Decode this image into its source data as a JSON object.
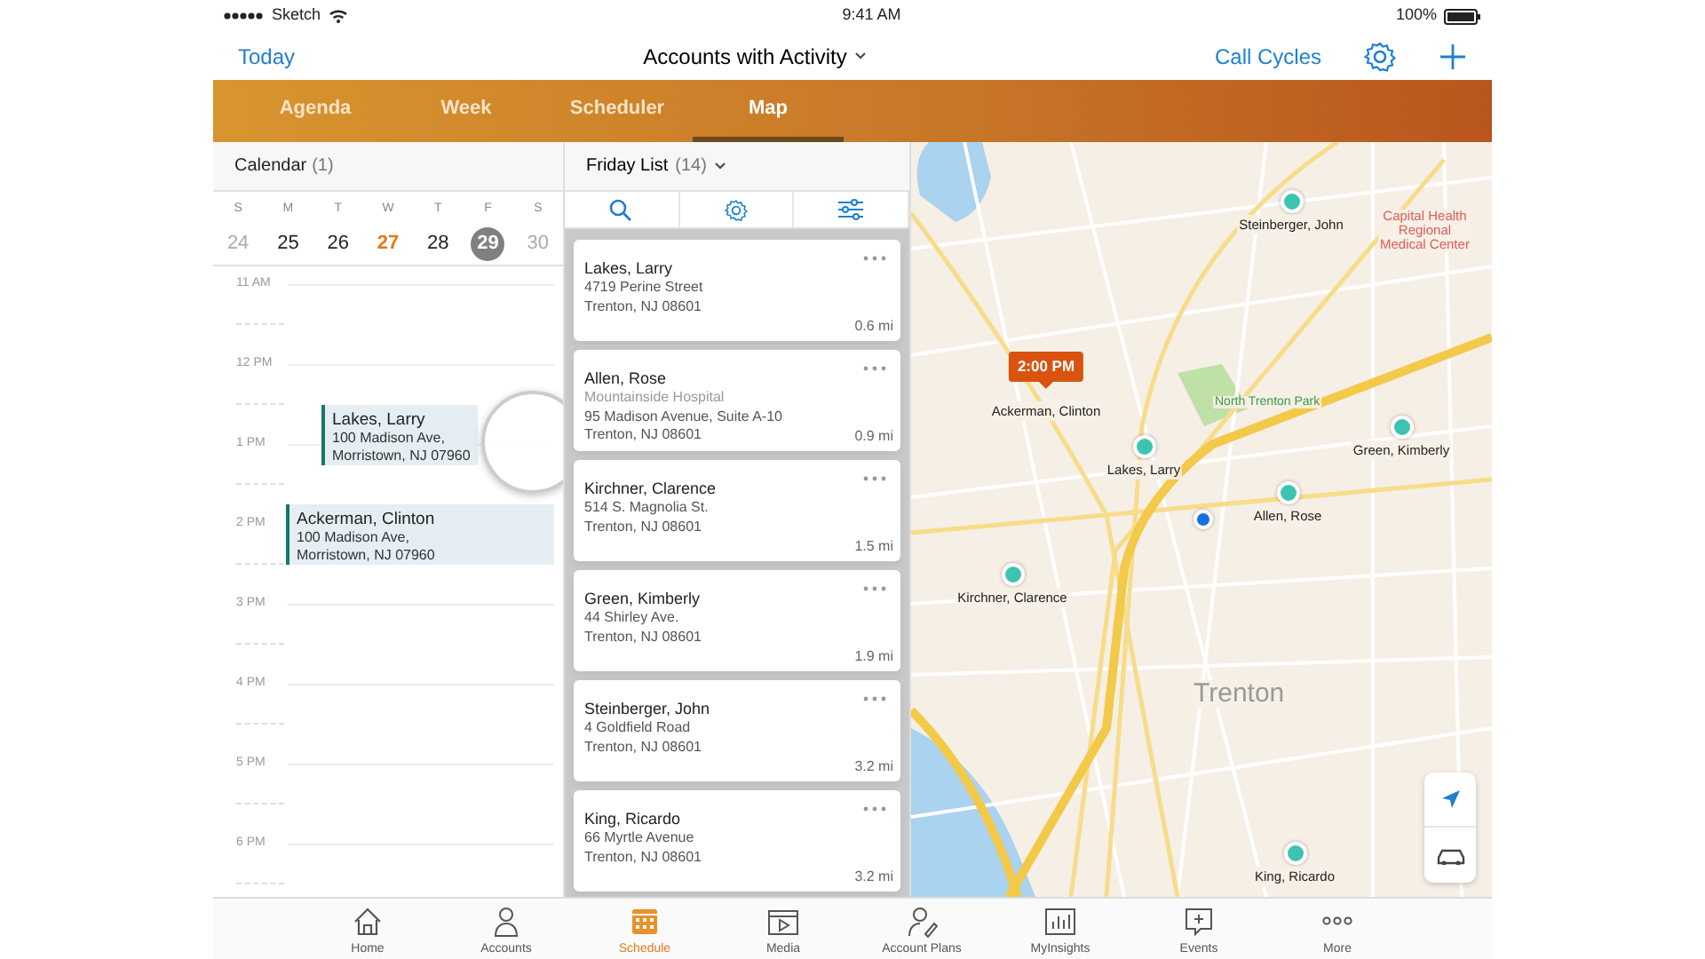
{
  "status_bar": {
    "carrier": "Sketch",
    "time": "9:41 AM",
    "battery": "100%"
  },
  "nav_bar": {
    "left": "Today",
    "title": "Accounts with Activity",
    "right": "Call Cycles"
  },
  "view_tabs": [
    {
      "label": "Agenda",
      "selected": false
    },
    {
      "label": "Week",
      "selected": false
    },
    {
      "label": "Scheduler",
      "selected": false
    },
    {
      "label": "Map",
      "selected": true
    }
  ],
  "calendar": {
    "title": "Calendar",
    "count": "(1)",
    "weekdays": [
      "S",
      "M",
      "T",
      "W",
      "T",
      "F",
      "S"
    ],
    "dates": [
      {
        "label": "24",
        "kind": "muted",
        "selected": false
      },
      {
        "label": "25",
        "kind": "normal",
        "selected": false
      },
      {
        "label": "26",
        "kind": "normal",
        "selected": false
      },
      {
        "label": "27",
        "kind": "today",
        "selected": false
      },
      {
        "label": "28",
        "kind": "normal",
        "selected": false
      },
      {
        "label": "29",
        "kind": "normal",
        "selected": true
      },
      {
        "label": "30",
        "kind": "muted",
        "selected": false
      }
    ],
    "slots": [
      {
        "time": "11 AM"
      },
      {
        "time": "12 PM"
      },
      {
        "time": "1 PM",
        "events": [
          {
            "name": "Lakes, Larry",
            "address": "100 Madison Ave,",
            "city": "Morristown, NJ 07960",
            "dragging": true
          }
        ]
      },
      {
        "time": "2 PM",
        "events": [
          {
            "name": "Ackerman, Clinton",
            "address": "100 Madison Ave,",
            "city": "Morristown, NJ 07960",
            "dragging": false
          }
        ]
      },
      {
        "time": "3 PM"
      },
      {
        "time": "4 PM"
      },
      {
        "time": "5 PM"
      },
      {
        "time": "6 PM"
      }
    ]
  },
  "list": {
    "title": "Friday List",
    "count": "(14)",
    "accounts": [
      {
        "name": "Lakes, Larry",
        "street": "4719 Perine Street",
        "city": "Trenton, NJ 08601",
        "distance": "0.6 mi"
      },
      {
        "name": "Allen, Rose",
        "organization": "Mountainside Hospital",
        "street": "95 Madison Avenue, Suite A-10",
        "city": "Trenton, NJ 08601",
        "distance": "0.9 mi"
      },
      {
        "name": "Kirchner, Clarence",
        "street": "514 S. Magnolia St.",
        "city": "Trenton, NJ 08601",
        "distance": "1.5 mi"
      },
      {
        "name": "Green, Kimberly",
        "street": "44 Shirley Ave.",
        "city": "Trenton, NJ 08601",
        "distance": "1.9 mi"
      },
      {
        "name": "Steinberger, John",
        "street": "4 Goldfield Road",
        "city": "Trenton, NJ 08601",
        "distance": "3.2 mi"
      },
      {
        "name": "King, Ricardo",
        "street": "66 Myrtle Avenue",
        "city": "Trenton, NJ 08601",
        "distance": "3.2 mi"
      }
    ]
  },
  "map": {
    "places": [
      "Capital Health\nRegional\nMedical Center",
      "North Trenton Park",
      "Trenton"
    ],
    "pins": [
      {
        "name": "Steinberger, John"
      },
      {
        "name": "Ackerman, Clinton",
        "callout": "2:00 PM"
      },
      {
        "name": "Lakes, Larry"
      },
      {
        "name": "Green, Kimberly"
      },
      {
        "name": "Allen, Rose"
      },
      {
        "name": "Kirchner, Clarence"
      },
      {
        "name": "King, Ricardo"
      }
    ]
  },
  "bottom_tabs": [
    {
      "label": "Home",
      "selected": false
    },
    {
      "label": "Accounts",
      "selected": false
    },
    {
      "label": "Schedule",
      "selected": true
    },
    {
      "label": "Media",
      "selected": false
    },
    {
      "label": "Account Plans",
      "selected": false
    },
    {
      "label": "MyInsights",
      "selected": false
    },
    {
      "label": "Events",
      "selected": false
    },
    {
      "label": "More",
      "selected": false
    }
  ]
}
